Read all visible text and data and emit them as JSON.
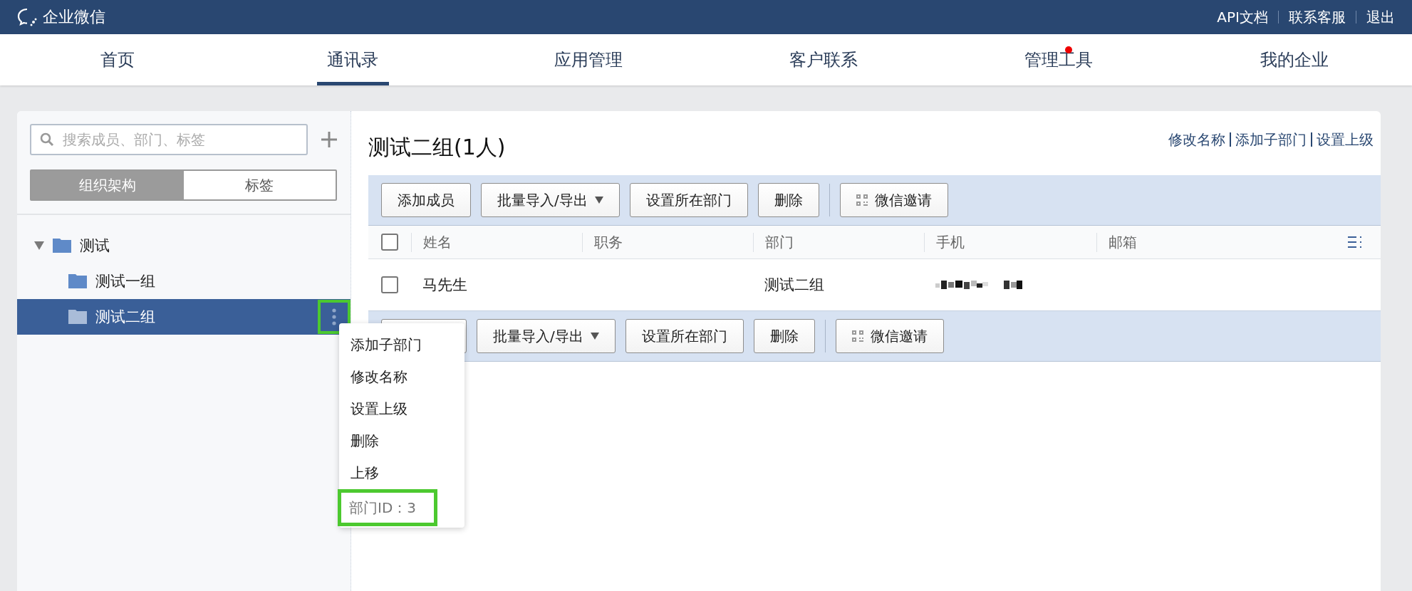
{
  "top_bar": {
    "brand": "企业微信",
    "links": [
      "API文档",
      "联系客服",
      "退出"
    ]
  },
  "nav": [
    {
      "label": "首页",
      "selected": false,
      "dot": false
    },
    {
      "label": "通讯录",
      "selected": true,
      "dot": false
    },
    {
      "label": "应用管理",
      "selected": false,
      "dot": false
    },
    {
      "label": "客户联系",
      "selected": false,
      "dot": false
    },
    {
      "label": "管理工具",
      "selected": false,
      "dot": true
    },
    {
      "label": "我的企业",
      "selected": false,
      "dot": false
    }
  ],
  "sidebar": {
    "search": {
      "placeholder": "搜索成员、部门、标签"
    },
    "tabs": [
      {
        "label": "组织架构",
        "selected": true
      },
      {
        "label": "标签",
        "selected": false
      }
    ],
    "tree": [
      {
        "label": "测试",
        "expanded": true,
        "selected": false,
        "children": [
          {
            "label": "测试一组",
            "selected": false,
            "highlight": false
          },
          {
            "label": "测试二组",
            "selected": true,
            "highlight": true
          }
        ]
      }
    ]
  },
  "context_menu": {
    "items": [
      {
        "label": "添加子部门",
        "kind": "action",
        "highlight": false
      },
      {
        "label": "修改名称",
        "kind": "action",
        "highlight": false
      },
      {
        "label": "设置上级",
        "kind": "action",
        "highlight": false
      },
      {
        "label": "删除",
        "kind": "action",
        "highlight": false
      },
      {
        "label": "上移",
        "kind": "action",
        "highlight": false
      },
      {
        "label": "部门ID：3",
        "kind": "info",
        "highlight": true
      }
    ]
  },
  "department": {
    "title": "测试二组(1人)",
    "links": [
      "修改名称",
      "添加子部门",
      "设置上级"
    ]
  },
  "toolbar": [
    {
      "label": "添加成员",
      "kind": "plain"
    },
    {
      "label": "批量导入/导出",
      "kind": "dropdown"
    },
    {
      "label": "设置所在部门",
      "kind": "plain"
    },
    {
      "label": "删除",
      "kind": "plain"
    },
    {
      "label": "微信邀请",
      "kind": "qr"
    }
  ],
  "toolbar_bottom": [
    {
      "kind": "plain"
    },
    {
      "label": "批量导入/导出",
      "kind": "dropdown"
    },
    {
      "label": "设置所在部门",
      "kind": "plain"
    },
    {
      "label": "删除",
      "kind": "plain"
    },
    {
      "label": "微信邀请",
      "kind": "qr"
    }
  ],
  "table": {
    "select_all": false,
    "columns": [
      "姓名",
      "职务",
      "部门",
      "手机",
      "邮箱"
    ],
    "rows": [
      {
        "checked": false,
        "name": "马先生",
        "department": "测试二组",
        "phone_redacted": true
      }
    ]
  }
}
